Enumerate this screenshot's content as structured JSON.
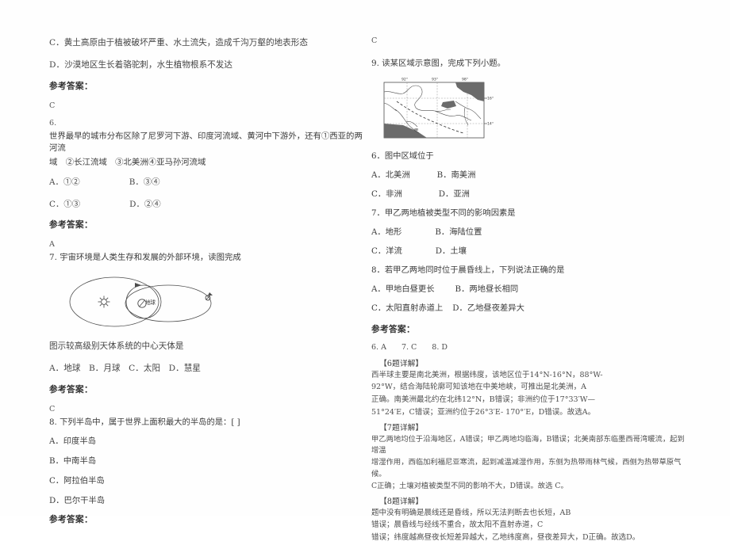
{
  "document": {
    "type": "geography-exam-answer-sheet",
    "background_color": "#ffffff",
    "text_color": "#4a4a4a"
  },
  "left_column": {
    "option_c_q5": "C．黄土高原由于植被破坏严重、水土流失，造成千沟万壑的地表形态",
    "option_d_q5": "D．沙漠地区生长着骆驼刺，水生植物根系不发达",
    "answer_label_1": "参考答案：",
    "answer_value_1": "C",
    "q6_number": "6.",
    "q6_stem_line1": "世界最早的城市分布区除了尼罗河下游、印度河流域、黄河中下游外，还有①西亚的两河流",
    "q6_stem_line2": "域　②长江流域　③北美洲④亚马孙河流域",
    "q6_opt_a": "A．①②",
    "q6_opt_b": "B．③④",
    "q6_opt_c": "C．①③",
    "q6_opt_d": "D．②④",
    "answer_label_2": "参考答案：",
    "answer_value_2": "A",
    "q7_stem": "7. 宇宙环境是人类生存和发展的外部环境，读图完成",
    "diagram_earth_label": "地球",
    "q7_question": "图示较高级别天体系统的中心天体是",
    "q7_options": "A．地球　B．月球　C．太阳　D．慧星",
    "answer_label_3": "参考答案：",
    "answer_value_3": "C",
    "q8_stem": "8. 下列半岛中，属于世界上面积最大的半岛的是：[        ]",
    "q8_opt_a": "A．印度半岛",
    "q8_opt_b": "B．中南半岛",
    "q8_opt_c": "C．阿拉伯半岛",
    "q8_opt_d": "D．巴尔干半岛",
    "answer_label_4": "参考答案："
  },
  "right_column": {
    "answer_value_top": "C",
    "q9_stem": "9. 读某区域示意图，完成下列小题。",
    "map": {
      "lon_labels": [
        "92°",
        "93°",
        "98°"
      ],
      "lat_labels": [
        "16°",
        "14°"
      ],
      "marker_label": "甲"
    },
    "q6_stem": "6．图中区域位于",
    "q6_opt_a": "A．北美洲",
    "q6_opt_b": "B．南美洲",
    "q6_opt_c": "C．非洲",
    "q6_opt_d": "D．亚洲",
    "q7_stem": "7．甲乙两地植被类型不同的影响因素是",
    "q7_opt_a": "A．地形",
    "q7_opt_b": "B．海陆位置",
    "q7_opt_c": "C．洋流",
    "q7_opt_d": "D．土壤",
    "q8_stem": "8．若甲乙两地同时位于晨昏线上，下列说法正确的是",
    "q8_opt_a": "A．甲地白昼更长",
    "q8_opt_b": "B．两地昼长相同",
    "q8_opt_c": "C．太阳直射赤道上",
    "q8_opt_d": "D．乙地昼夜差异大",
    "answer_label": "参考答案：",
    "answer_values": "6. A　　7. C　　8. D",
    "exp6_head": "【6题详解】",
    "exp6_l1": "西半球主要是南北美洲，根据纬度，该地区位于14°N-16°N，88°W-",
    "exp6_l2": "92°W，结合海陆轮廓可知该地在中美地峡，可推出是北美洲，A",
    "exp6_l3": "正确。南美洲最北约在北纬12°N，B错误；非洲约位于17°33′W—",
    "exp6_l4": "51°24′E，C错误；亚洲约位于26°3′E- 170°′E，D错误。故选A。",
    "exp7_head": "【7题详解】",
    "exp7_l1": "甲乙两地均位于沿海地区，A错误；甲乙两地均临海，B错误；北美南部东临墨西哥湾暖流，起到增温",
    "exp7_l2": "增湿作用，西临加利福尼亚寒流，起到减温减湿作用，东侧为热带雨林气候，西侧为热带草原气候。",
    "exp7_l3": "C正确；土壤对植被类型不同的影响不大，D错误。故选 C。",
    "exp8_head": "【8题详解】",
    "exp8_l1": "题中没有明确是晨线还是昏线，所以无法判断去也长短，AB",
    "exp8_l2": "错误；晨昏线与经线不重合，故太阳不直射赤道，C",
    "exp8_l3": "错误；纬度越高昼夜长短差异越大，乙地纬度高，昼夜差异大，D正确。故选D。"
  }
}
